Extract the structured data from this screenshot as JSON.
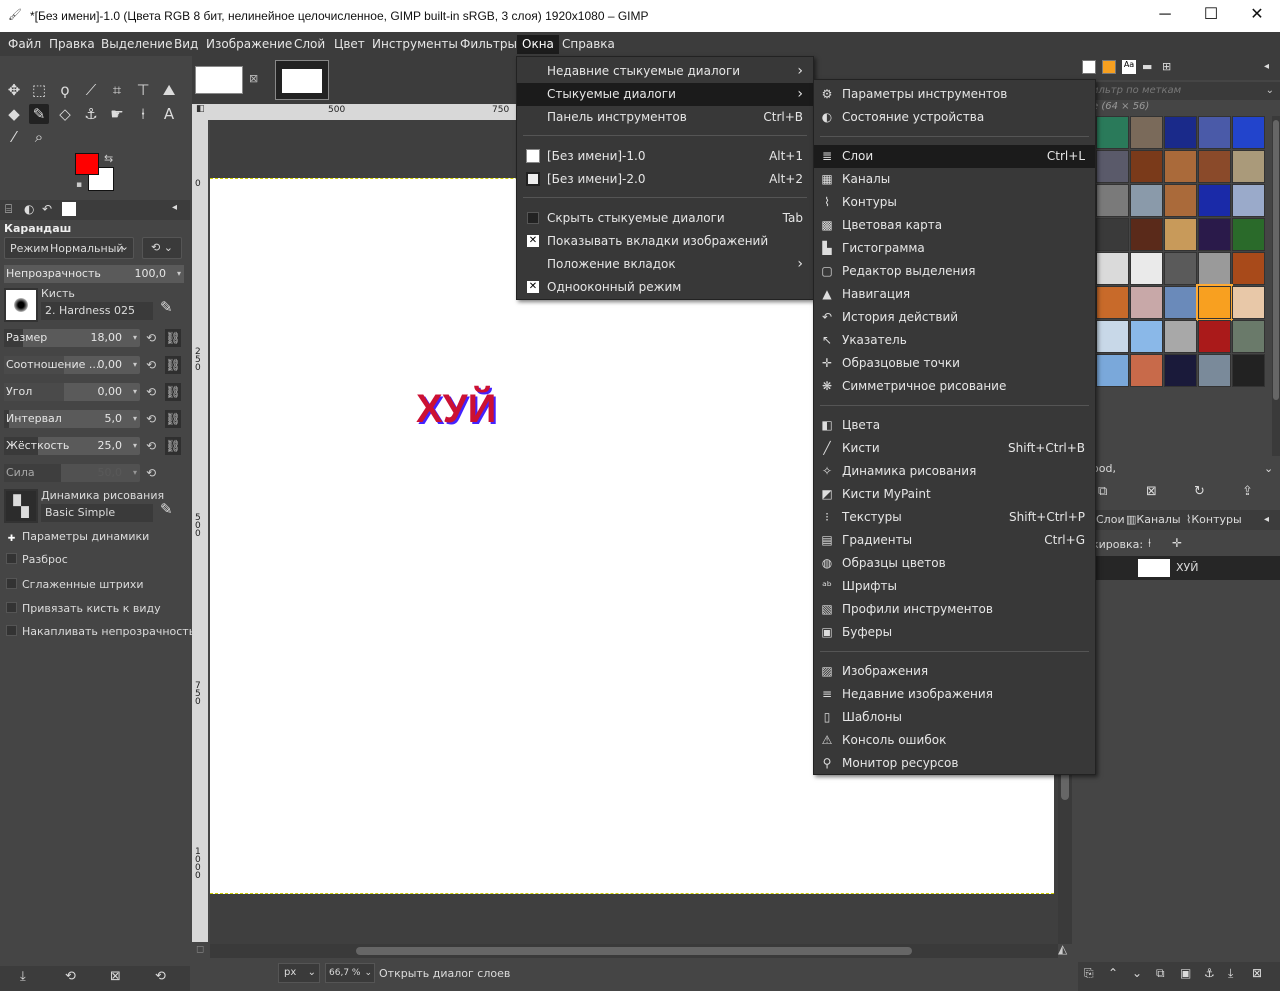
{
  "window": {
    "title": "*[Без имени]-1.0 (Цвета RGB 8 бит, нелинейное целочисленное, GIMP built-in sRGB, 3 слоя) 1920x1080 – GIMP",
    "minimize": "─",
    "maximize": "☐",
    "close": "✕"
  },
  "menubar": [
    "Файл",
    "Правка",
    "Выделение",
    "Вид",
    "Изображение",
    "Слой",
    "Цвет",
    "Инструменты",
    "Фильтры",
    "Окна",
    "Справка"
  ],
  "toolbox": {
    "tool_name": "Карандаш",
    "mode_label": "Режим",
    "mode_value": "Нормальный",
    "opacity": {
      "label": "Непрозрачность",
      "value": "100,0"
    },
    "brush_label": "Кисть",
    "brush_value": "2. Hardness 025",
    "size": {
      "label": "Размер",
      "value": "18,00"
    },
    "ratio": {
      "label": "Соотношение ...",
      "value": "0,00"
    },
    "angle": {
      "label": "Угол",
      "value": "0,00"
    },
    "spacing": {
      "label": "Интервал",
      "value": "5,0"
    },
    "hardness": {
      "label": "Жёсткость",
      "value": "25,0"
    },
    "force": {
      "label": "Сила",
      "value": "50,0"
    },
    "dynamics_label": "Динамика рисования",
    "dynamics_value": "Basic Simple",
    "options": [
      {
        "label": "Параметры динамики",
        "checked": true
      },
      {
        "label": "Разброс",
        "checked": false
      },
      {
        "label": "Сглаженные штрихи",
        "checked": false
      },
      {
        "label": "Привязать кисть к виду",
        "checked": false
      },
      {
        "label": "Накапливать непрозрачность",
        "checked": false
      }
    ],
    "fg_color": "#ff0000",
    "bg_color": "#ffffff"
  },
  "canvas": {
    "ruler_labels": [
      "500",
      "750"
    ],
    "vruler_labels": [
      "0",
      "250",
      "500",
      "750",
      "1000"
    ],
    "text": "ХУЙ",
    "text_color": "#cc1133",
    "text_shadow": "#4422ff"
  },
  "statusbar": {
    "unit": "px",
    "zoom": "66,7 %",
    "message": "Открыть диалог слоев"
  },
  "windows_menu": [
    {
      "label": "Недавние стыкуемые диалоги",
      "shortcut": "",
      "submenu": true
    },
    {
      "label": "Стыкуемые диалоги",
      "shortcut": "",
      "submenu": true,
      "highlighted": true
    },
    {
      "label": "Панель инструментов",
      "shortcut": "Ctrl+B"
    },
    {
      "label": "[Без имени]-1.0",
      "shortcut": "Alt+1"
    },
    {
      "label": "[Без имени]-2.0",
      "shortcut": "Alt+2"
    },
    {
      "label": "Скрыть стыкуемые диалоги",
      "shortcut": "Tab"
    },
    {
      "label": "Показывать вкладки изображений",
      "shortcut": ""
    },
    {
      "label": "Положение вкладок",
      "shortcut": "",
      "submenu": true
    },
    {
      "label": "Однооконный режим",
      "shortcut": ""
    }
  ],
  "dock_menu": [
    {
      "label": "Параметры инструментов",
      "shortcut": "",
      "icon": "⚙"
    },
    {
      "label": "Состояние устройства",
      "shortcut": "",
      "icon": "◐"
    },
    {
      "label": "Слои",
      "shortcut": "Ctrl+L",
      "icon": "≣",
      "highlighted": true
    },
    {
      "label": "Каналы",
      "shortcut": "",
      "icon": "▦"
    },
    {
      "label": "Контуры",
      "shortcut": "",
      "icon": "⌇"
    },
    {
      "label": "Цветовая карта",
      "shortcut": "",
      "icon": "▩"
    },
    {
      "label": "Гистограмма",
      "shortcut": "",
      "icon": "▙"
    },
    {
      "label": "Редактор выделения",
      "shortcut": "",
      "icon": "▢"
    },
    {
      "label": "Навигация",
      "shortcut": "",
      "icon": "▲"
    },
    {
      "label": "История действий",
      "shortcut": "",
      "icon": "↶"
    },
    {
      "label": "Указатель",
      "shortcut": "",
      "icon": "↖"
    },
    {
      "label": "Образцовые точки",
      "shortcut": "",
      "icon": "✛"
    },
    {
      "label": "Симметричное рисование",
      "shortcut": "",
      "icon": "❋"
    },
    {
      "label": "Цвета",
      "shortcut": "",
      "icon": "◧"
    },
    {
      "label": "Кисти",
      "shortcut": "Shift+Ctrl+B",
      "icon": "╱"
    },
    {
      "label": "Динамика рисования",
      "shortcut": "",
      "icon": "✧"
    },
    {
      "label": "Кисти MyPaint",
      "shortcut": "",
      "icon": "◩"
    },
    {
      "label": "Текстуры",
      "shortcut": "Shift+Ctrl+P",
      "icon": "⁝"
    },
    {
      "label": "Градиенты",
      "shortcut": "Ctrl+G",
      "icon": "▤"
    },
    {
      "label": "Образцы цветов",
      "shortcut": "",
      "icon": "◍"
    },
    {
      "label": "Шрифты",
      "shortcut": "",
      "icon": "ᵃᵇ"
    },
    {
      "label": "Профили инструментов",
      "shortcut": "",
      "icon": "▧"
    },
    {
      "label": "Буферы",
      "shortcut": "",
      "icon": "▣"
    },
    {
      "label": "Изображения",
      "shortcut": "",
      "icon": "▨"
    },
    {
      "label": "Недавние изображения",
      "shortcut": "",
      "icon": "≡"
    },
    {
      "label": "Шаблоны",
      "shortcut": "",
      "icon": "▯"
    },
    {
      "label": "Консоль ошибок",
      "shortcut": "",
      "icon": "⚠"
    },
    {
      "label": "Монитор ресурсов",
      "shortcut": "",
      "icon": "⚲"
    }
  ],
  "right_panel": {
    "filter_placeholder": "ильтр по меткам",
    "pattern_size": "е (64 × 56)",
    "pattern_name": "ood,",
    "tabs": [
      "Слои",
      "Каналы",
      "Контуры"
    ],
    "lock_label": "кировка:",
    "layer_name": "ХУЙ"
  }
}
